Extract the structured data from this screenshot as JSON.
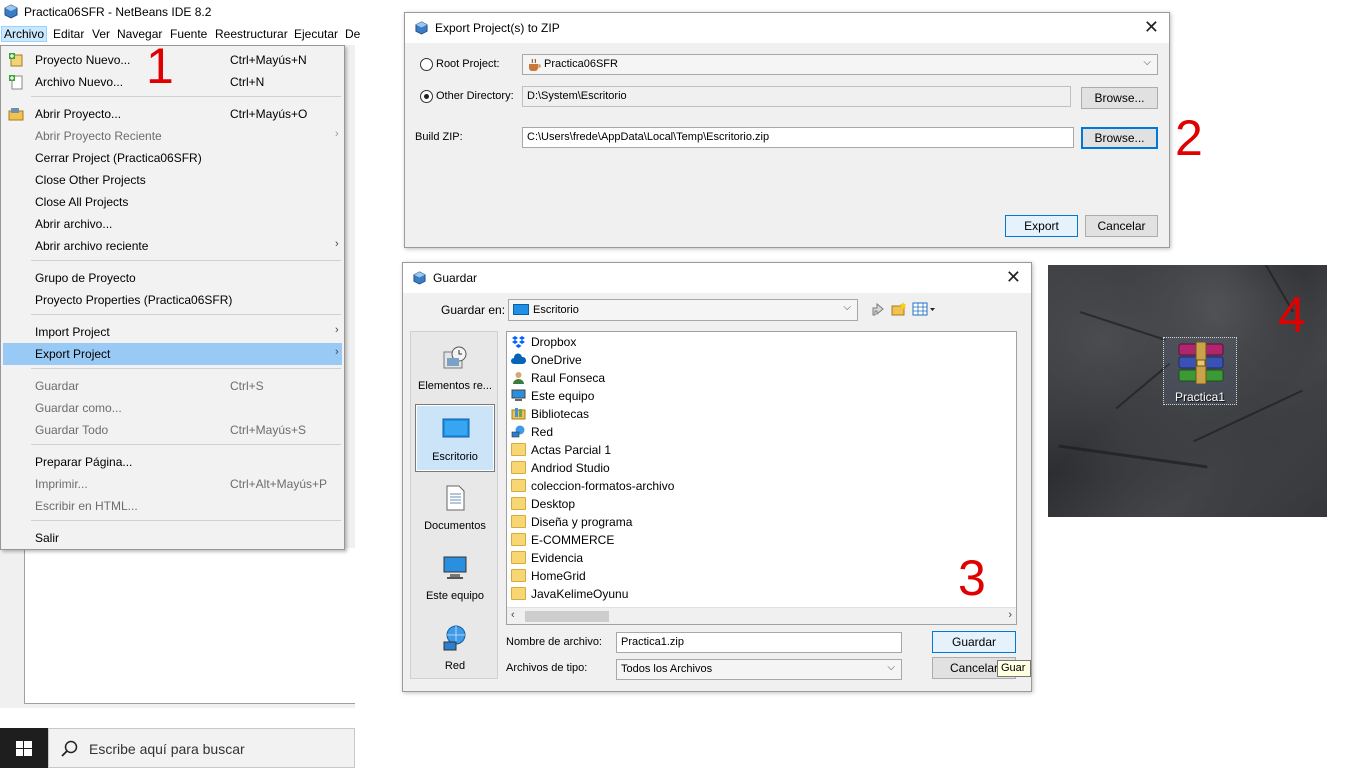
{
  "netbeans": {
    "title": "Practica06SFR - NetBeans IDE 8.2",
    "menubar": [
      "Archivo",
      "Editar",
      "Ver",
      "Navegar",
      "Fuente",
      "Reestructurar",
      "Ejecutar",
      "De"
    ],
    "file_menu": [
      {
        "label": "Proyecto Nuevo...",
        "shortcut": "Ctrl+Mayús+N"
      },
      {
        "label": "Archivo Nuevo...",
        "shortcut": "Ctrl+N"
      },
      {
        "label": "Abrir Proyecto...",
        "shortcut": "Ctrl+Mayús+O"
      },
      {
        "label": "Abrir Proyecto Reciente",
        "shortcut": ""
      },
      {
        "label": "Cerrar Project (Practica06SFR)",
        "shortcut": ""
      },
      {
        "label": "Close Other Projects",
        "shortcut": ""
      },
      {
        "label": "Close All Projects",
        "shortcut": ""
      },
      {
        "label": "Abrir archivo...",
        "shortcut": ""
      },
      {
        "label": "Abrir archivo reciente",
        "shortcut": ""
      },
      {
        "label": "Grupo de Proyecto",
        "shortcut": ""
      },
      {
        "label": "Proyecto Properties (Practica06SFR)",
        "shortcut": ""
      },
      {
        "label": "Import Project",
        "shortcut": ""
      },
      {
        "label": "Export Project",
        "shortcut": ""
      },
      {
        "label": "Guardar",
        "shortcut": "Ctrl+S"
      },
      {
        "label": "Guardar como...",
        "shortcut": ""
      },
      {
        "label": "Guardar Todo",
        "shortcut": "Ctrl+Mayús+S"
      },
      {
        "label": "Preparar Página...",
        "shortcut": ""
      },
      {
        "label": "Imprimir...",
        "shortcut": "Ctrl+Alt+Mayús+P"
      },
      {
        "label": "Escribir en HTML...",
        "shortcut": ""
      },
      {
        "label": "Salir",
        "shortcut": ""
      }
    ]
  },
  "taskbar": {
    "search_placeholder": "Escribe aquí para buscar"
  },
  "step_numbers": [
    "1",
    "2",
    "3",
    "4"
  ],
  "export_dialog": {
    "title": "Export Project(s) to ZIP",
    "root_project_label": "Root Project:",
    "root_project_value": "Practica06SFR",
    "other_directory_label": "Other Directory:",
    "other_directory_value": "D:\\System\\Escritorio",
    "build_zip_label": "Build ZIP:",
    "build_zip_value": "C:\\Users\\frede\\AppData\\Local\\Temp\\Escritorio.zip",
    "browse_label": "Browse...",
    "export_label": "Export",
    "cancel_label": "Cancelar"
  },
  "save_dialog": {
    "title": "Guardar",
    "save_in_label": "Guardar en:",
    "save_in_value": "Escritorio",
    "places": [
      "Elementos re...",
      "Escritorio",
      "Documentos",
      "Este equipo",
      "Red"
    ],
    "files": [
      "Dropbox",
      "OneDrive",
      "Raul Fonseca",
      "Este equipo",
      "Bibliotecas",
      "Red",
      "Actas Parcial 1",
      "Andriod Studio",
      "coleccion-formatos-archivo",
      "Desktop",
      "Diseña y programa",
      "E-COMMERCE",
      "Evidencia",
      "HomeGrid",
      "JavaKelimeOyunu"
    ],
    "filename_label": "Nombre de archivo:",
    "filename_value": "Practica1.zip",
    "filetype_label": "Archivos de tipo:",
    "filetype_value": "Todos los Archivos",
    "save_label": "Guardar",
    "cancel_label": "Cancelar",
    "tooltip": "Guar"
  },
  "desktop": {
    "zip_name": "Practica1"
  }
}
